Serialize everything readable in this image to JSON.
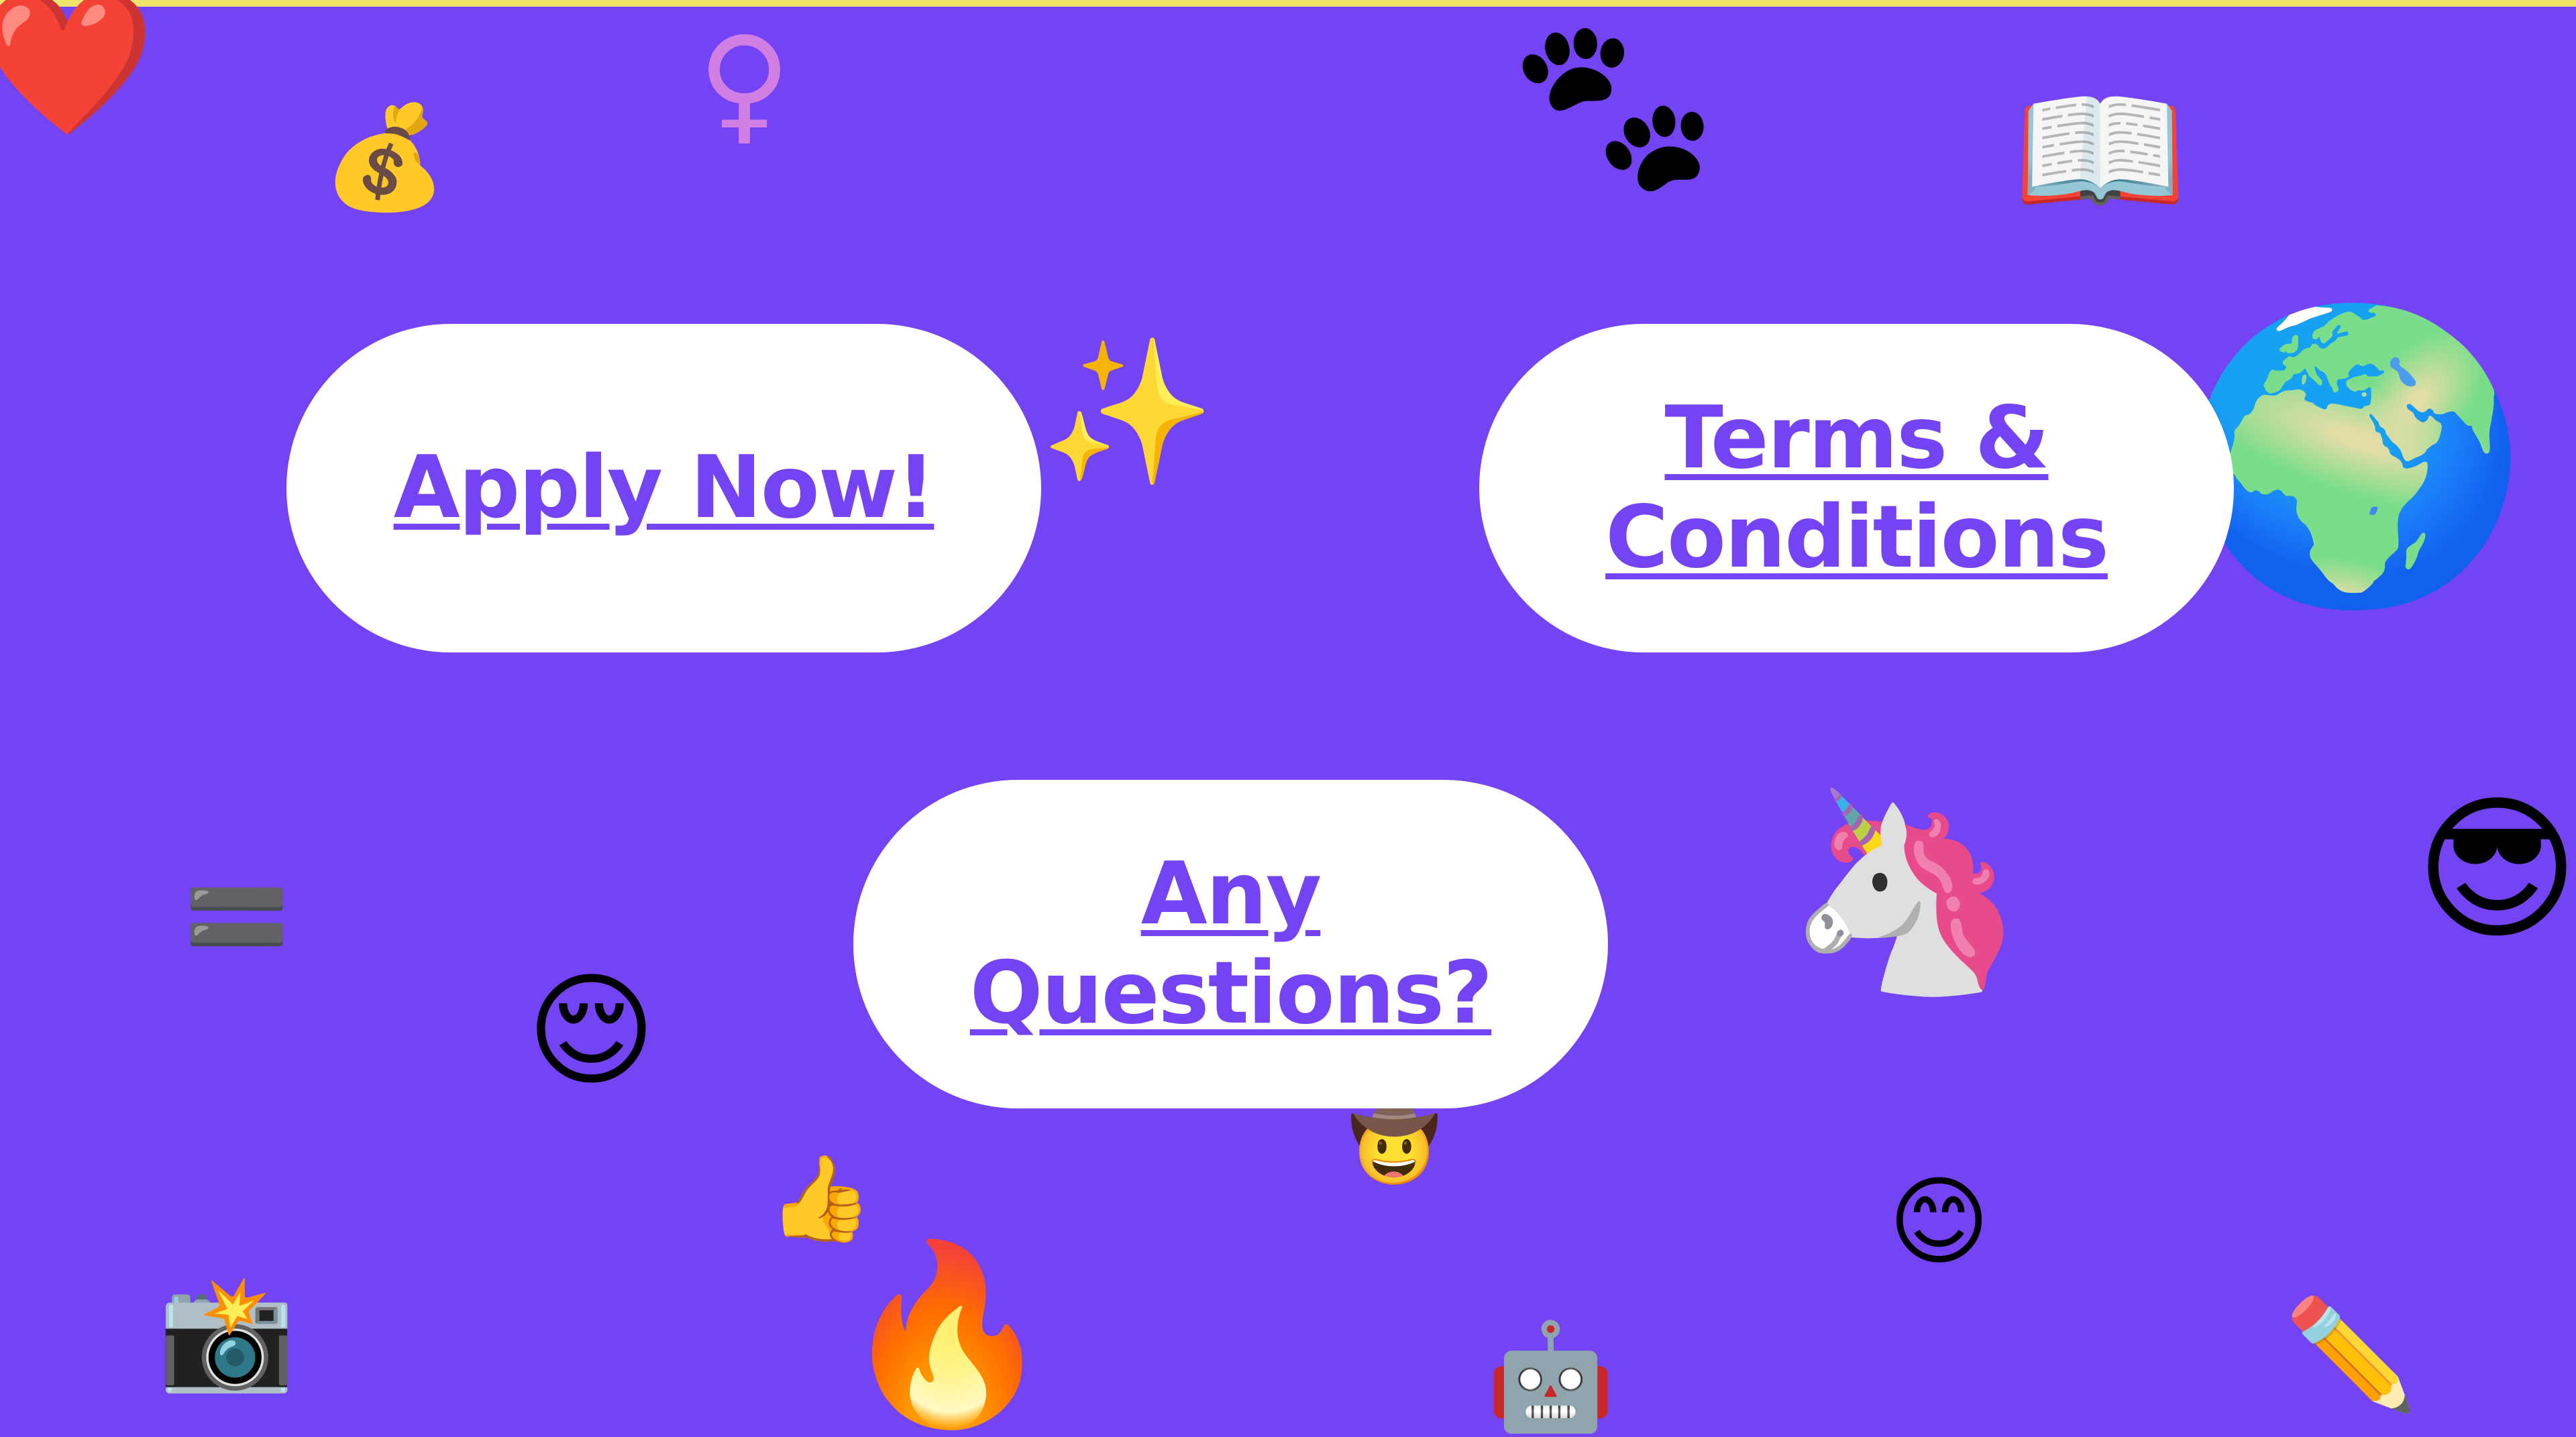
{
  "theme": {
    "background": "#7444F4",
    "top_strip": "#EFE46B",
    "button_bg": "#FFFFFF",
    "button_text": "#7444F4"
  },
  "buttons": {
    "apply": "Apply Now!",
    "terms": "Terms & Conditions",
    "questions": "Any Questions?"
  },
  "emojis": {
    "heart": "❤️",
    "money_bag": "💰",
    "female_sign": "♀",
    "paw_prints": "🐾",
    "open_book": "📖",
    "sparkles": "✨",
    "globe": "🌍",
    "equals": "🟰",
    "relieved": "😌",
    "unicorn": "🦄",
    "cool": "😎",
    "cowboy": "🤠",
    "thumbs_up": "👍",
    "smile": "😊",
    "camera": "📸",
    "fire": "🔥",
    "robot": "🤖",
    "pencil": "✏️"
  }
}
